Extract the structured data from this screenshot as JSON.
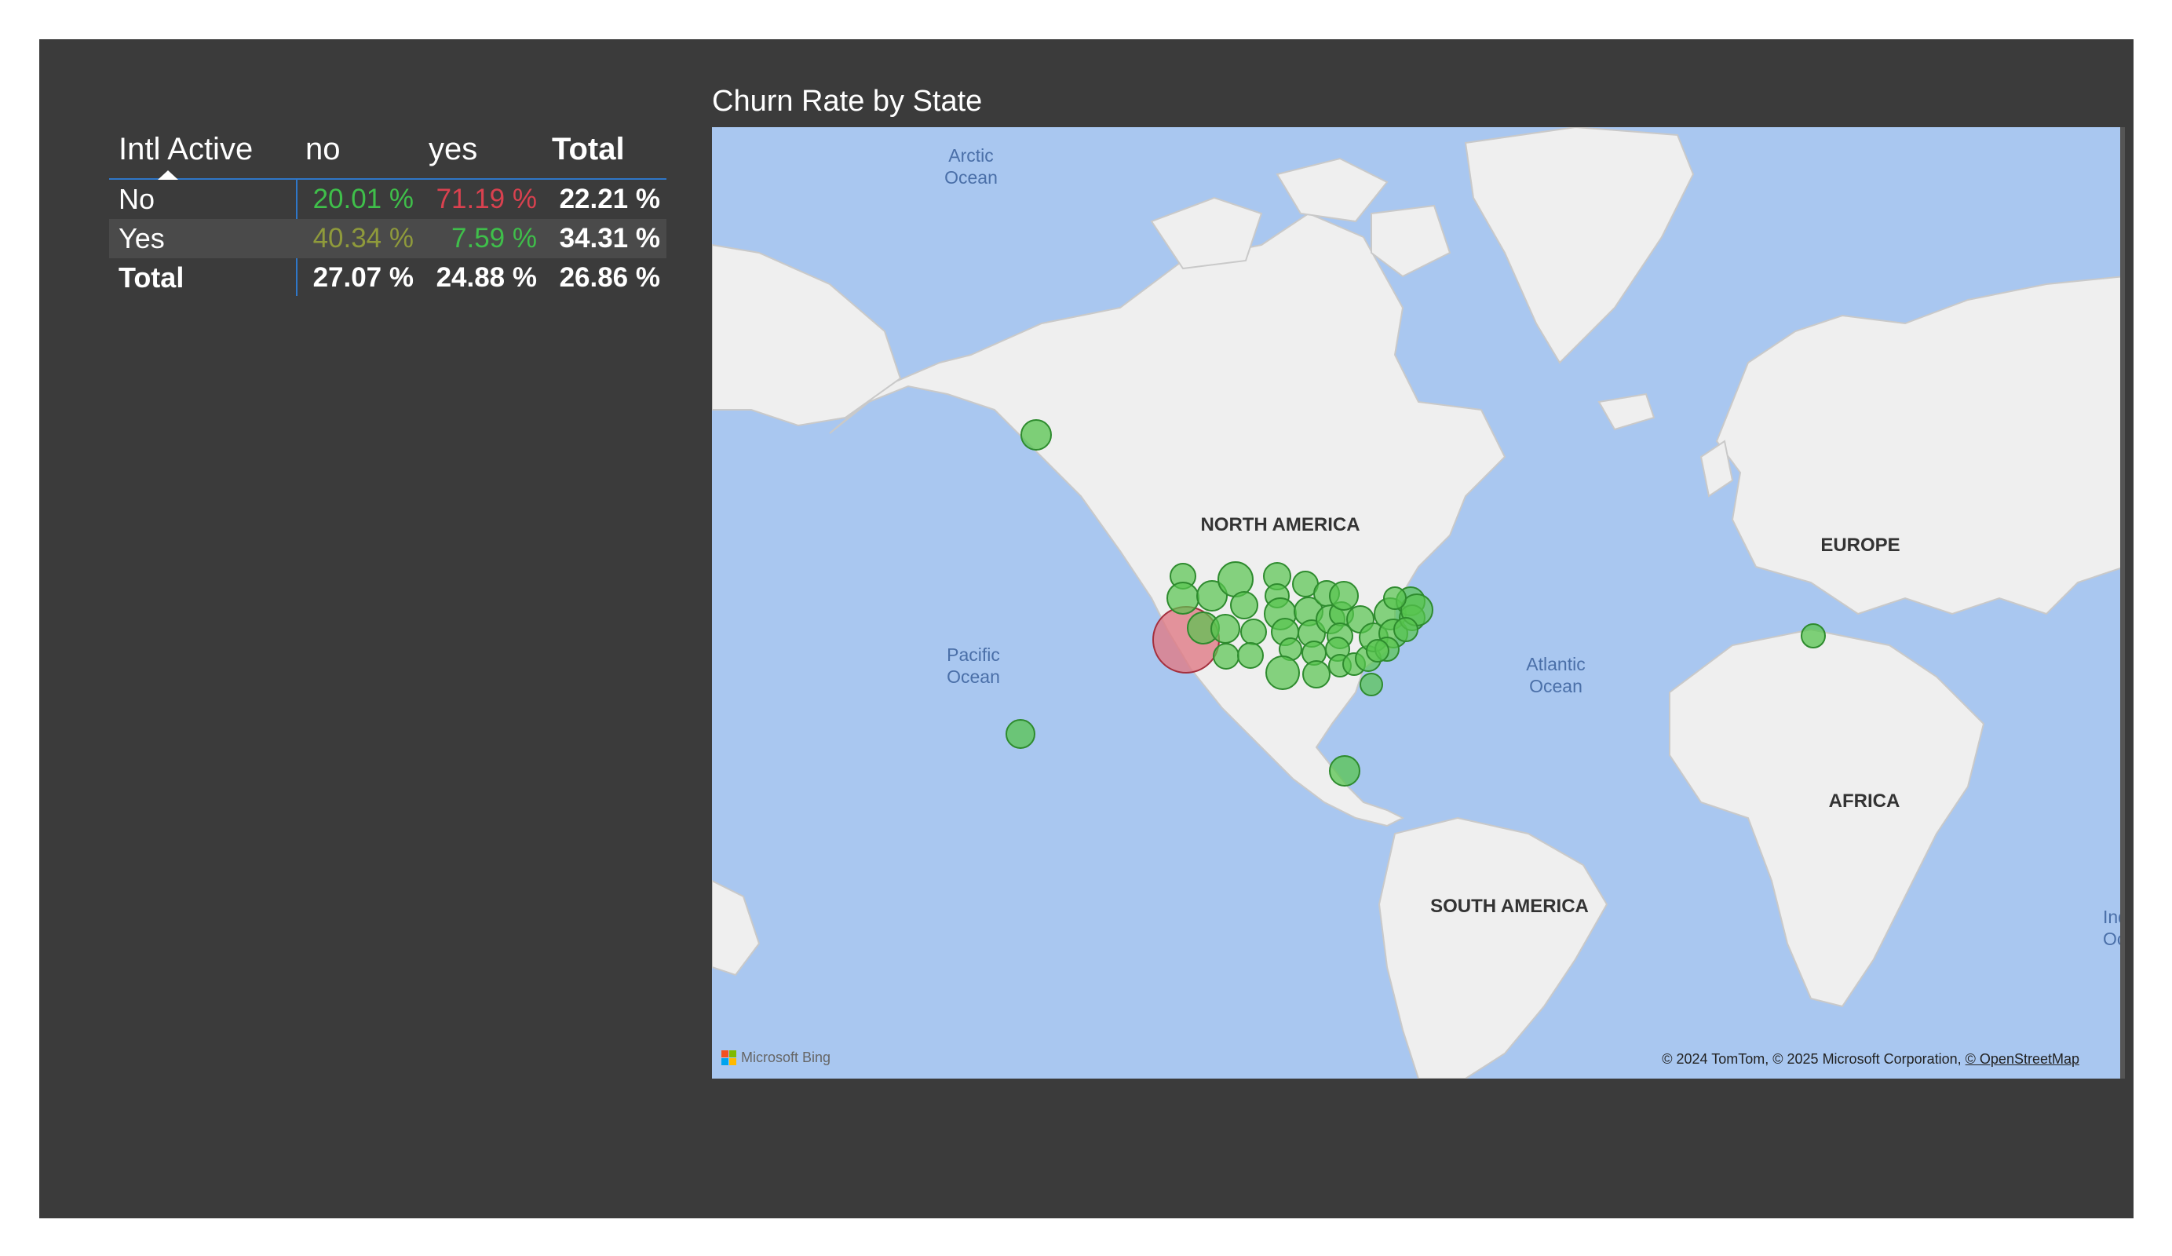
{
  "matrix": {
    "header": {
      "row_label": "Intl Active",
      "cols": [
        "no",
        "yes",
        "Total"
      ]
    },
    "rows": [
      {
        "label": "No",
        "values": [
          "20.01 %",
          "71.19 %",
          "22.21 %"
        ],
        "colors": [
          "#3fbf4a",
          "#d9414f",
          "#ffffff"
        ]
      },
      {
        "label": "Yes",
        "values": [
          "40.34 %",
          "7.59 %",
          "34.31 %"
        ],
        "colors": [
          "#8f9a3b",
          "#3fbf4a",
          "#ffffff"
        ]
      },
      {
        "label": "Total",
        "values": [
          "27.07 %",
          "24.88 %",
          "26.86 %"
        ],
        "colors": [
          "#ffffff",
          "#ffffff",
          "#ffffff"
        ]
      }
    ],
    "sort_icon": "sort-up-triangle-icon"
  },
  "map": {
    "title": "Churn Rate by State",
    "labels": {
      "arctic": [
        "Arctic",
        "Ocean"
      ],
      "pacific": [
        "Pacific",
        "Ocean"
      ],
      "atlantic": [
        "Atlantic",
        "Ocean"
      ],
      "indian": [
        "India",
        "Ocea"
      ],
      "north_america": "NORTH AMERICA",
      "south_america": "SOUTH AMERICA",
      "europe": "EUROPE",
      "africa": "AFRICA"
    },
    "bing_label": "Microsoft Bing",
    "attribution": "© 2024 TomTom, © 2025 Microsoft Corporation,",
    "attribution_link": "© OpenStreetMap",
    "colors": {
      "water": "#a9c7f0",
      "land": "#efefef",
      "bubble_green": "#57c44f",
      "bubble_red": "#e07a86"
    }
  }
}
